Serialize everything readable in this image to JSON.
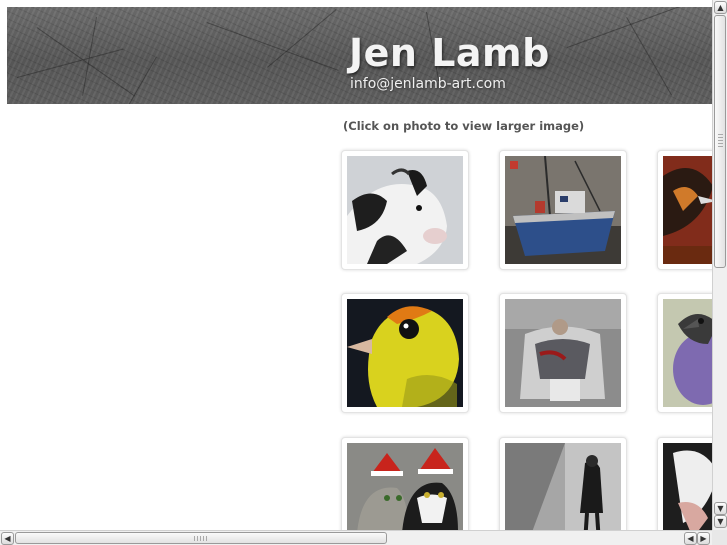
{
  "header": {
    "title": "Jen Lamb",
    "email": "info@jenlamb-art.com"
  },
  "gallery": {
    "hint": "(Click on photo to view larger image)",
    "thumbnails": [
      {
        "name": "cow-painting"
      },
      {
        "name": "fishing-boat-painting"
      },
      {
        "name": "bird-on-red-painting"
      },
      {
        "name": "yellow-finch-painting"
      },
      {
        "name": "man-sleeping-painting"
      },
      {
        "name": "purple-bird-painting"
      },
      {
        "name": "cats-santa-hats-painting"
      },
      {
        "name": "figure-street-painting"
      },
      {
        "name": "black-white-animal-painting"
      }
    ]
  },
  "scrollbars": {
    "up_icon": "scroll-up-arrow",
    "down_icon": "scroll-down-arrow",
    "left_icon": "scroll-left-arrow",
    "right_icon": "scroll-right-arrow"
  }
}
